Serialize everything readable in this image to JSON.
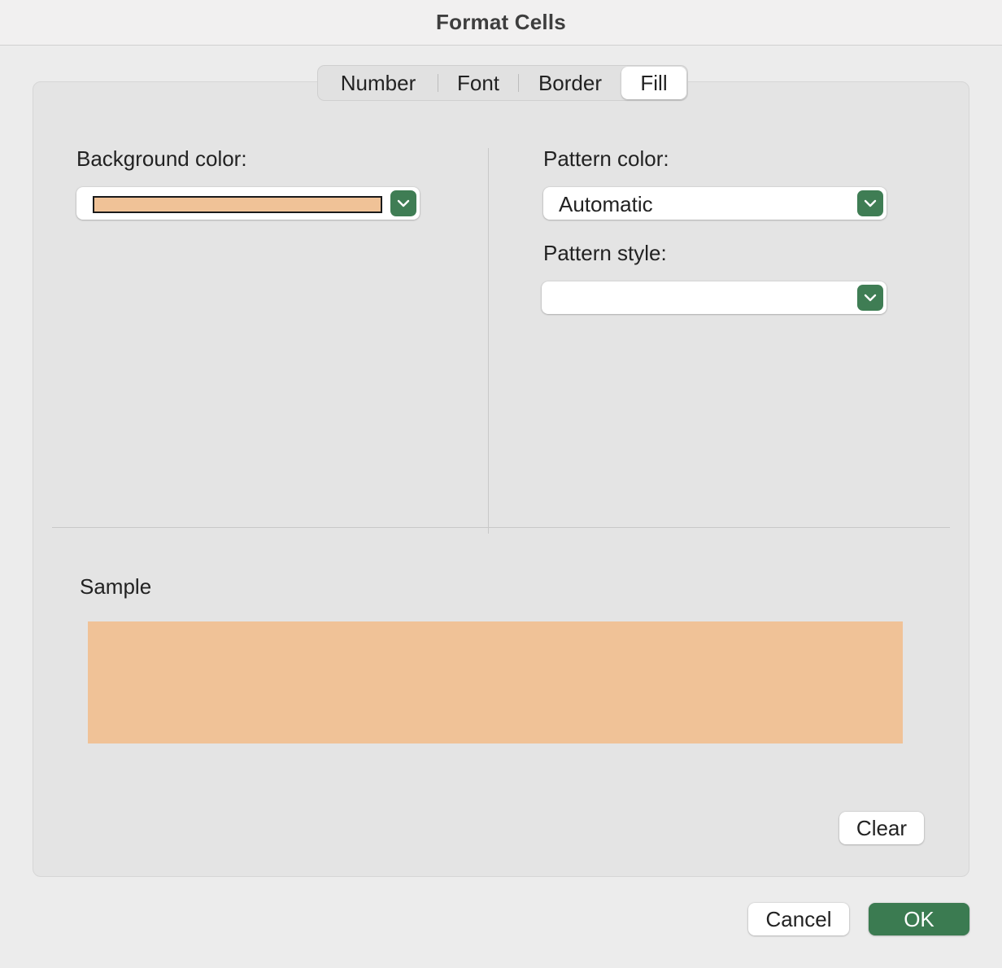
{
  "window": {
    "title": "Format Cells"
  },
  "tabs": [
    {
      "label": "Number",
      "selected": false
    },
    {
      "label": "Font",
      "selected": false
    },
    {
      "label": "Border",
      "selected": false
    },
    {
      "label": "Fill",
      "selected": true
    }
  ],
  "background": {
    "label": "Background color:",
    "selected_color": "#f0c297",
    "icon": "chevron-down-icon"
  },
  "pattern_color": {
    "label": "Pattern color:",
    "value": "Automatic",
    "icon": "chevron-down-icon"
  },
  "pattern_style": {
    "label": "Pattern style:",
    "value": "",
    "icon": "chevron-down-icon"
  },
  "sample": {
    "label": "Sample",
    "color": "#f0c297"
  },
  "buttons": {
    "clear": "Clear",
    "cancel": "Cancel",
    "ok": "OK"
  },
  "colors": {
    "accent": "#3b7b51",
    "panel": "#e4e4e4",
    "window": "#ececec"
  }
}
